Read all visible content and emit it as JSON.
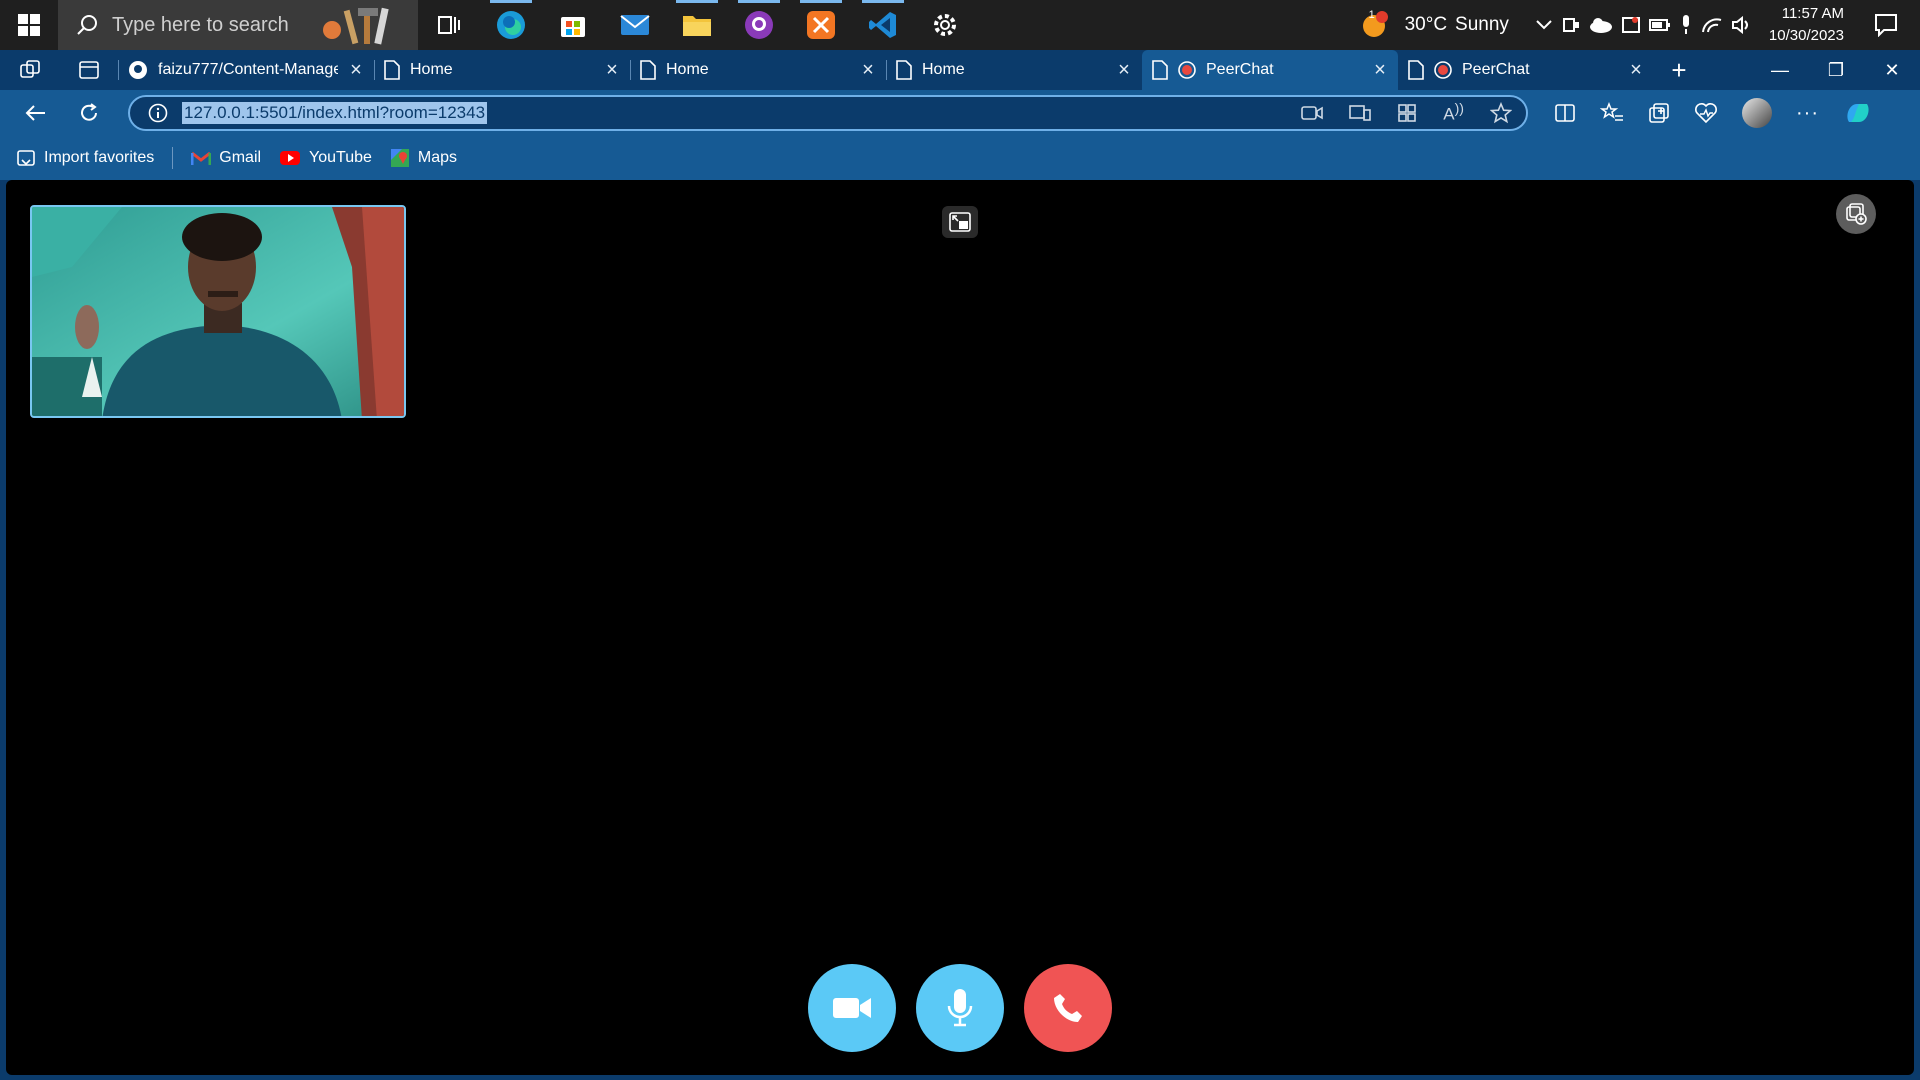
{
  "taskbar": {
    "search_placeholder": "Type here to search",
    "apps": [
      "task-view",
      "edge",
      "store",
      "mail",
      "file-explorer",
      "github-desktop",
      "xampp",
      "vscode",
      "settings"
    ],
    "weather": {
      "badge": "1",
      "temp": "30°C",
      "condition": "Sunny"
    },
    "clock": {
      "time": "11:57 AM",
      "date": "10/30/2023"
    }
  },
  "tabs": [
    {
      "title": "faizu777/Content-Manage",
      "icon": "github-icon",
      "active": false
    },
    {
      "title": "Home",
      "icon": "page-icon",
      "active": false
    },
    {
      "title": "Home",
      "icon": "page-icon",
      "active": false
    },
    {
      "title": "Home",
      "icon": "page-icon",
      "active": false
    },
    {
      "title": "PeerChat",
      "icon": "recording-icon",
      "active": true
    },
    {
      "title": "PeerChat",
      "icon": "recording-icon",
      "active": false
    }
  ],
  "address_bar": {
    "url": "127.0.0.1:5501/index.html?room=12343"
  },
  "favorites": [
    {
      "label": "Import favorites",
      "icon": "import-icon"
    },
    {
      "label": "Gmail",
      "icon": "gmail-icon"
    },
    {
      "label": "YouTube",
      "icon": "youtube-icon"
    },
    {
      "label": "Maps",
      "icon": "maps-icon"
    }
  ],
  "colors": {
    "browser_dark": "#0b3b6b",
    "browser_mid": "#165a94",
    "call_button": "#5bc9f6",
    "end_call": "#f05454"
  }
}
